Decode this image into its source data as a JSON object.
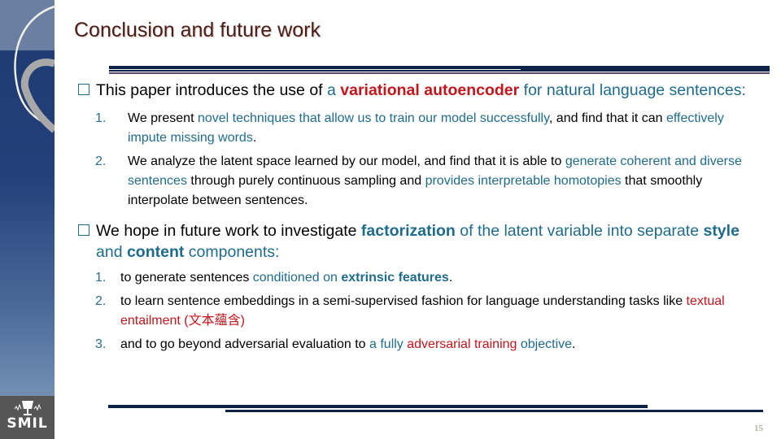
{
  "slide": {
    "title": "Conclusion and future work",
    "page_number": "15",
    "logo_text": "SMIL",
    "colors": {
      "title": "#4a1e1a",
      "accent_blue": "#1f6b8c",
      "accent_red": "#c0161c",
      "rule_navy": "#0e2147",
      "rule_purple": "#5a4570"
    }
  },
  "bullets": [
    {
      "icon": "square-bullet-icon",
      "segments": [
        {
          "text": "This paper introduces the use of ",
          "style": "plain"
        },
        {
          "text": "a ",
          "style": "blue"
        },
        {
          "text": "variational autoencoder",
          "style": "red-bold"
        },
        {
          "text": " for natural language sentences:",
          "style": "blue"
        }
      ],
      "items": [
        {
          "number": "1.",
          "segments": [
            {
              "text": "We present ",
              "style": "plain"
            },
            {
              "text": "novel techniques that allow us to train our model successfully",
              "style": "blue"
            },
            {
              "text": ", and find that it can ",
              "style": "plain"
            },
            {
              "text": "effectively impute missing words",
              "style": "blue"
            },
            {
              "text": ".",
              "style": "plain"
            }
          ]
        },
        {
          "number": "2.",
          "segments": [
            {
              "text": "We analyze the latent space learned by our model, and find that it is able to ",
              "style": "plain"
            },
            {
              "text": "generate coherent and diverse sentences",
              "style": "blue"
            },
            {
              "text": " through purely continuous sampling and ",
              "style": "plain"
            },
            {
              "text": "provides interpretable homotopies",
              "style": "blue"
            },
            {
              "text": " that smoothly interpolate between sentences.",
              "style": "plain"
            }
          ]
        }
      ]
    },
    {
      "icon": "square-bullet-icon",
      "segments": [
        {
          "text": "We hope in future work to investigate ",
          "style": "plain"
        },
        {
          "text": "factorization",
          "style": "blue-bold"
        },
        {
          "text": " of the latent variable into separate ",
          "style": "blue"
        },
        {
          "text": "style",
          "style": "blue-bold"
        },
        {
          "text": " and ",
          "style": "blue"
        },
        {
          "text": "content",
          "style": "blue-bold"
        },
        {
          "text": " components:",
          "style": "blue"
        }
      ],
      "items": [
        {
          "number": "1.",
          "segments": [
            {
              "text": "to generate sentences ",
              "style": "plain"
            },
            {
              "text": "conditioned on ",
              "style": "blue"
            },
            {
              "text": "extrinsic features",
              "style": "blue-bold"
            },
            {
              "text": ".",
              "style": "plain"
            }
          ]
        },
        {
          "number": "2.",
          "segments": [
            {
              "text": "to learn sentence embeddings in a semi-supervised fashion for language understanding tasks like ",
              "style": "plain"
            },
            {
              "text": "textual entailment (文本蘊含)",
              "style": "red"
            }
          ]
        },
        {
          "number": "3.",
          "segments": [
            {
              "text": "and to go beyond adversarial evaluation to ",
              "style": "plain"
            },
            {
              "text": "a fully ",
              "style": "blue"
            },
            {
              "text": "adversarial training",
              "style": "red"
            },
            {
              "text": " objective",
              "style": "blue"
            },
            {
              "text": ".",
              "style": "plain"
            }
          ]
        }
      ]
    }
  ]
}
